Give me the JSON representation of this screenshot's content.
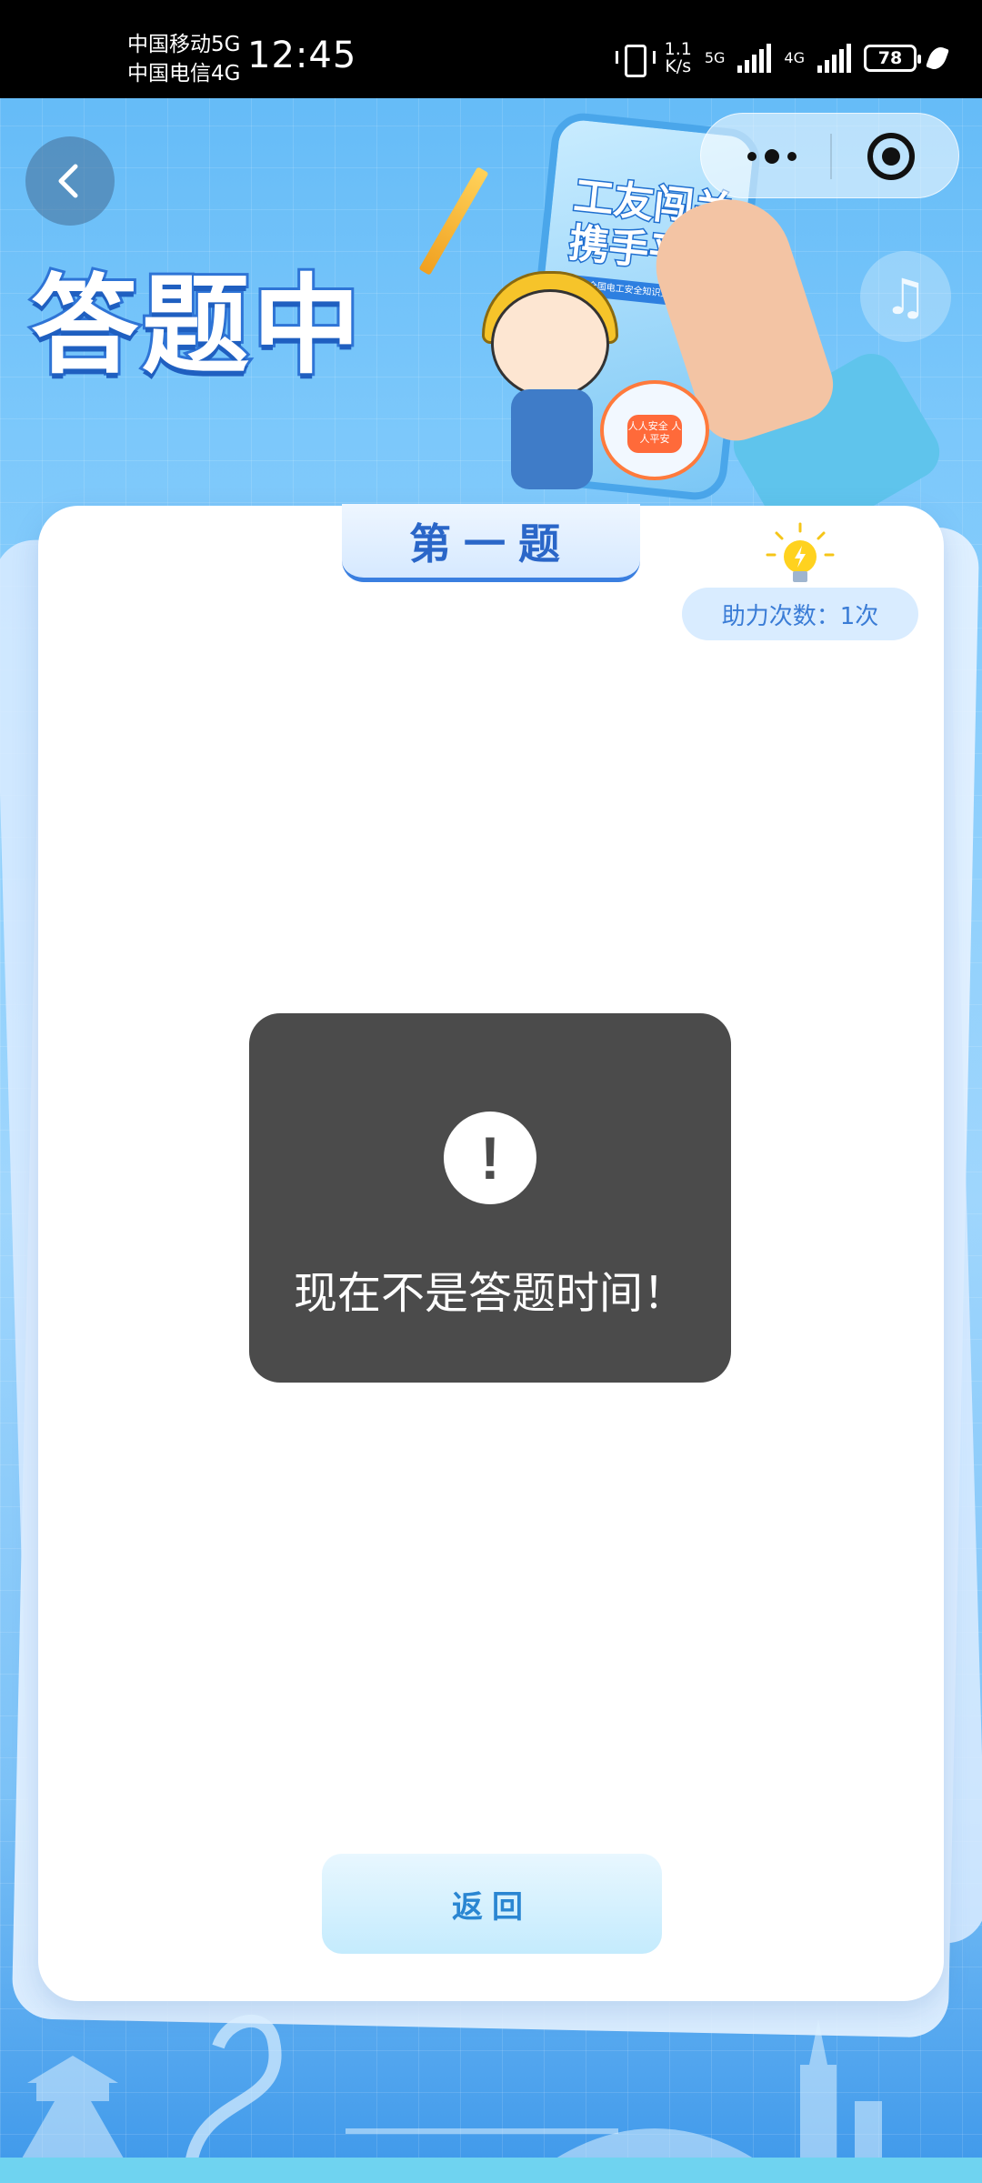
{
  "status_bar": {
    "carrier_1": "中国移动5G",
    "carrier_2": "中国电信4G",
    "time": "12:45",
    "speed_value": "1.1",
    "speed_unit": "K/s",
    "net_1": "5G",
    "net_2": "4G",
    "battery": "78",
    "icons": [
      "vibrate-icon",
      "signal-icon",
      "battery-icon",
      "leaf-icon"
    ]
  },
  "header": {
    "title": "答题中",
    "back_icon": "chevron-left-icon",
    "menu_icon": "more-icon",
    "close_icon": "target-icon",
    "music_icon": "♫"
  },
  "banner": {
    "title_line1": "工友闯关",
    "title_line2": "携手平安",
    "subtitle": "2026年全国电工安全知识竞赛主题系列活动",
    "badge_text": "人人安全 人人平安"
  },
  "card": {
    "question_tab": "第一题",
    "help_label": "助力次数：",
    "help_count": "1次",
    "back_button": "返回"
  },
  "toast": {
    "icon": "!",
    "message": "现在不是答题时间！"
  },
  "colors": {
    "accent": "#2a66c8",
    "toast_bg": "#4b4b4b",
    "background_top": "#5fb8f6"
  }
}
